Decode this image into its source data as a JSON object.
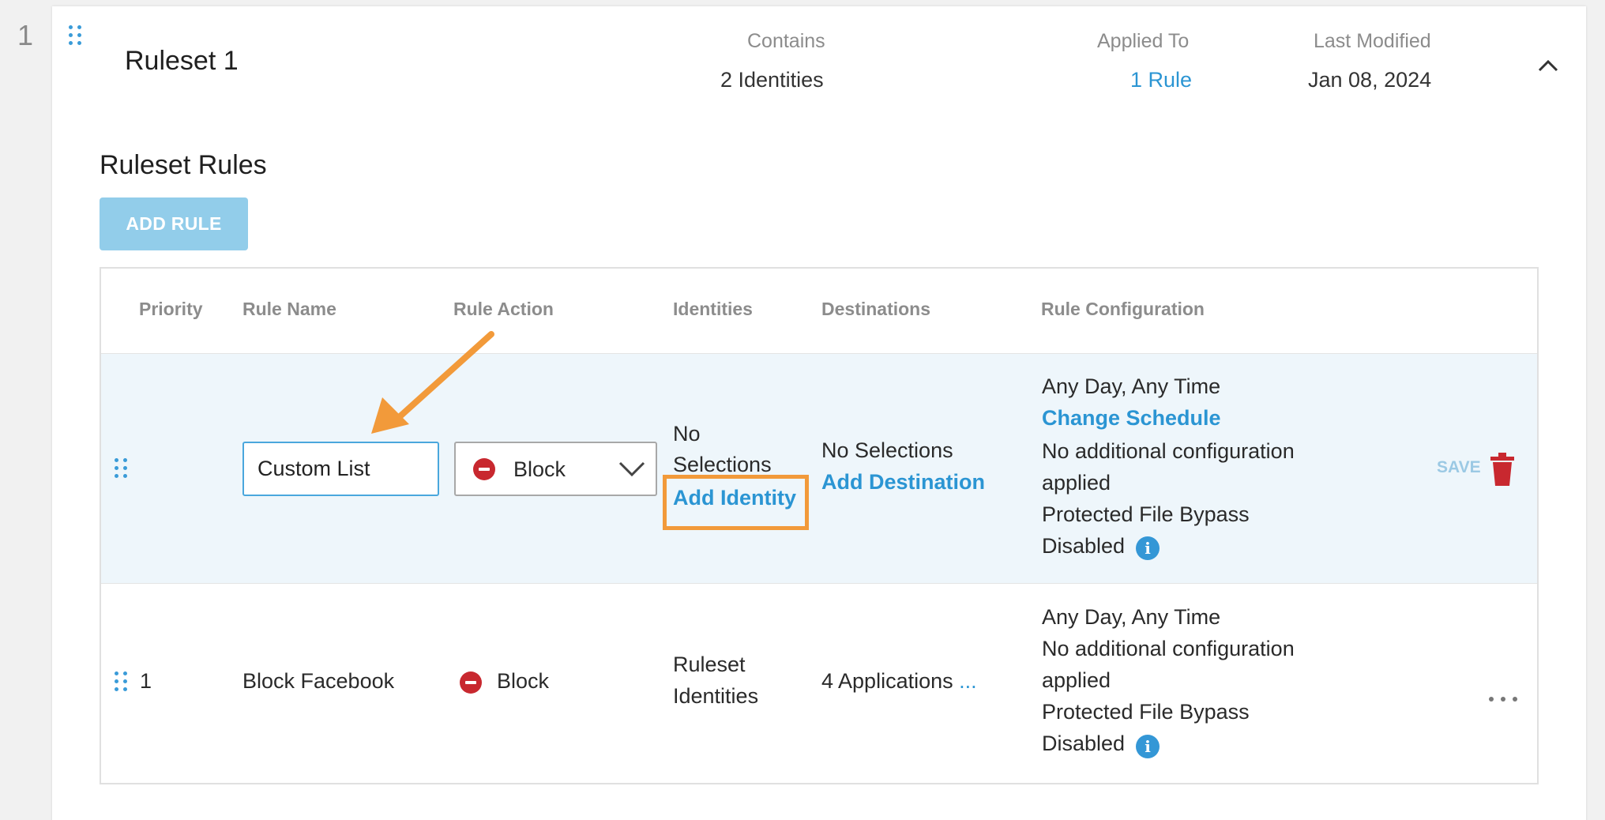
{
  "row_index": "1",
  "ruleset": {
    "title": "Ruleset 1",
    "contains": {
      "label": "Contains",
      "value": "2 Identities"
    },
    "applied_to": {
      "label": "Applied To",
      "value": "1 Rule"
    },
    "last_modified": {
      "label": "Last Modified",
      "value": "Jan 08, 2024"
    }
  },
  "rules_section": {
    "title": "Ruleset Rules",
    "add_rule_label": "ADD RULE"
  },
  "table": {
    "headers": {
      "priority": "Priority",
      "rule_name": "Rule Name",
      "rule_action": "Rule Action",
      "identities": "Identities",
      "destinations": "Destinations",
      "rule_configuration": "Rule Configuration"
    },
    "edit_row": {
      "rule_name_value": "Custom List",
      "rule_action": "Block",
      "identities_line1": "No",
      "identities_line2": "Selections",
      "add_identity": "Add Identity",
      "destinations": "No Selections",
      "add_destination": "Add Destination",
      "schedule": "Any Day, Any Time",
      "change_schedule": "Change Schedule",
      "config_line1": "No additional configuration",
      "config_line2": "applied",
      "bypass_line1": "Protected File Bypass",
      "bypass_line2": "Disabled",
      "save_label": "SAVE"
    },
    "rows": [
      {
        "priority": "1",
        "rule_name": "Block Facebook",
        "rule_action": "Block",
        "identities_line1": "Ruleset",
        "identities_line2": "Identities",
        "destinations": "4 Applications",
        "destinations_more": "...",
        "schedule": "Any Day, Any Time",
        "config_line1": "No additional configuration",
        "config_line2": "applied",
        "bypass_line1": "Protected File Bypass",
        "bypass_line2": "Disabled"
      }
    ]
  },
  "colors": {
    "accent": "#2b95d3",
    "block_red": "#c8282f",
    "annotation_orange": "#f29a3a",
    "edit_row_bg": "#eef6fb"
  }
}
